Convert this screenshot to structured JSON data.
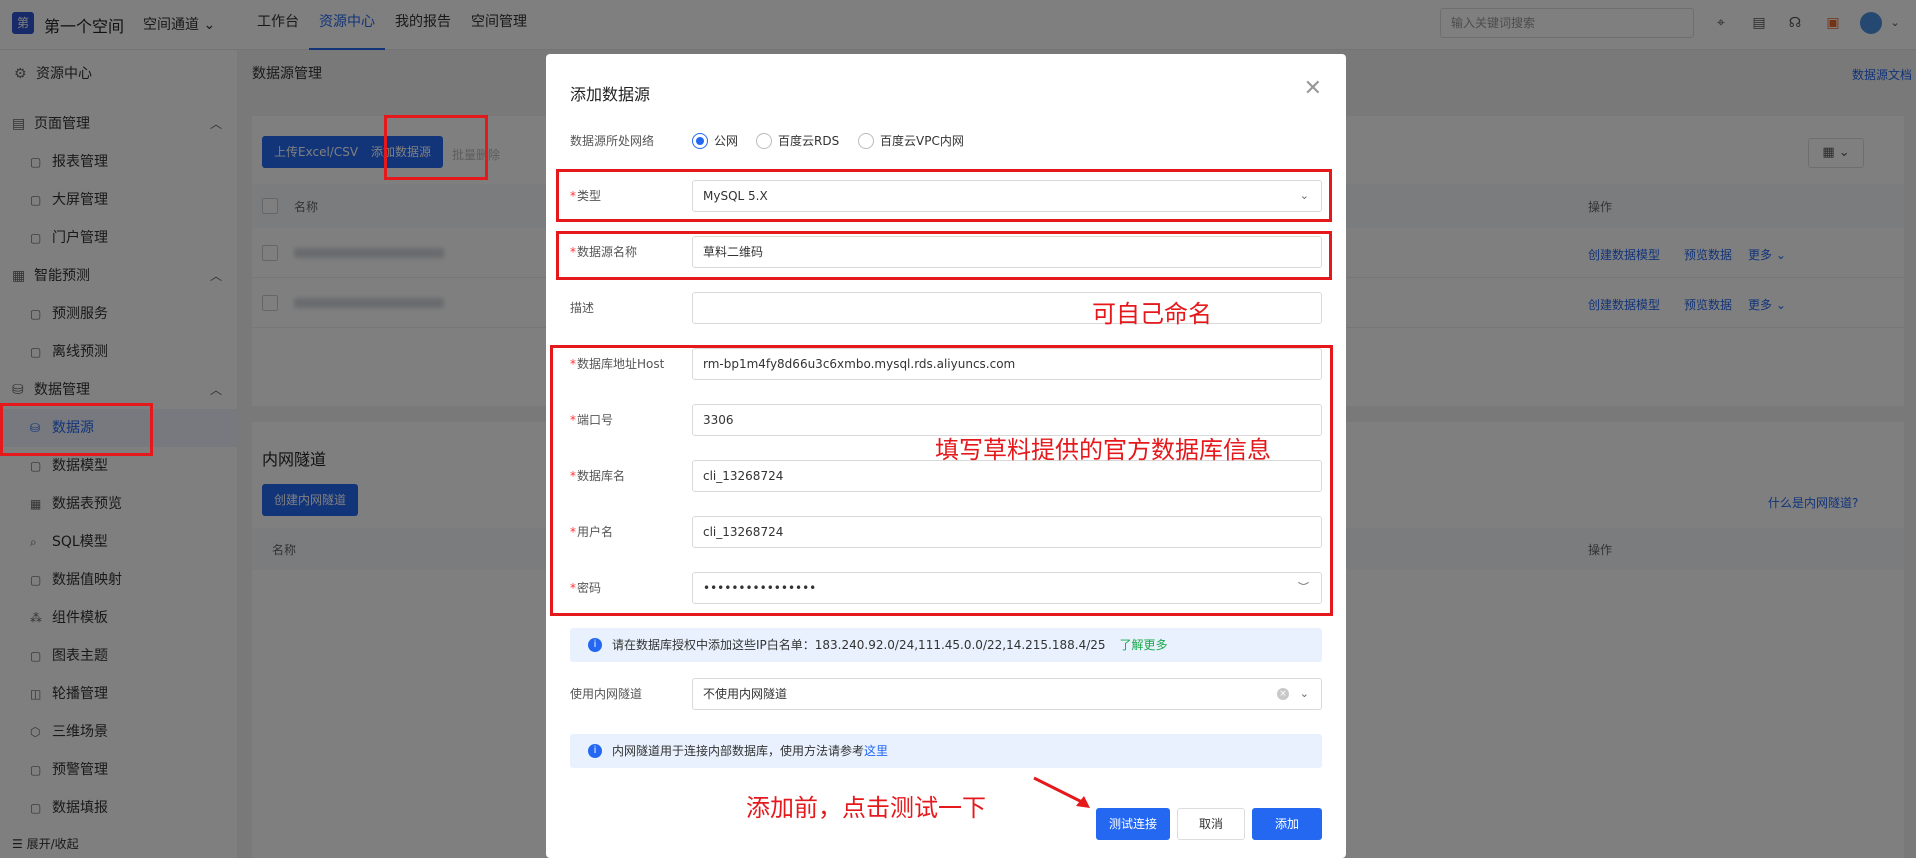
{
  "topbar": {
    "logo": "第",
    "space_name": "第一个空间",
    "space_switch": "空间通道",
    "nav": [
      "工作台",
      "资源中心",
      "我的报告",
      "空间管理"
    ],
    "search_placeholder": "输入关键词搜索"
  },
  "sidebar": {
    "header": "资源中心",
    "groups": [
      {
        "label": "页面管理",
        "items": [
          "报表管理",
          "大屏管理",
          "门户管理"
        ]
      },
      {
        "label": "智能预测",
        "items": [
          "预测服务",
          "离线预测"
        ]
      },
      {
        "label": "数据管理",
        "items": [
          "数据源",
          "数据模型",
          "数据表预览",
          "SQL模型",
          "数据值映射",
          "组件模板",
          "图表主题",
          "轮播管理",
          "三维场景",
          "预警管理",
          "数据填报"
        ]
      }
    ],
    "active_item": "数据源",
    "footer": "展开/收起"
  },
  "main": {
    "breadcrumb": "数据源管理",
    "doc_link": "数据源文档",
    "upload_button": "上传Excel/CSV",
    "add_button": "添加数据源",
    "batch_delete": "批量删除",
    "table_headers": {
      "name": "名称",
      "actions": "操作"
    },
    "rows": [
      {
        "actions": [
          "创建数据模型",
          "预览数据",
          "更多"
        ]
      },
      {
        "actions": [
          "创建数据模型",
          "预览数据",
          "更多"
        ]
      }
    ],
    "row_fragment": "m",
    "tunnel_title": "内网隧道",
    "create_tunnel_button": "创建内网隧道",
    "tunnel_help": "什么是内网隧道?",
    "tunnel_headers": {
      "name": "名称",
      "actions": "操作"
    }
  },
  "modal": {
    "title": "添加数据源",
    "network_label": "数据源所处网络",
    "network_options": [
      "公网",
      "百度云RDS",
      "百度云VPC内网"
    ],
    "network_selected": "公网",
    "type_label": "类型",
    "type_value": "MySQL 5.X",
    "name_label": "数据源名称",
    "name_value": "草料二维码",
    "desc_label": "描述",
    "desc_value": "",
    "host_label": "数据库地址Host",
    "host_value": "rm-bp1m4fy8d66u3c6xmbo.mysql.rds.aliyuncs.com",
    "port_label": "端口号",
    "port_value": "3306",
    "db_label": "数据库名",
    "db_value": "cli_13268724",
    "user_label": "用户名",
    "user_value": "cli_13268724",
    "password_label": "密码",
    "password_value": "••••••••••••••••",
    "whitelist_notice": "请在数据库授权中添加这些IP白名单：183.240.92.0/24,111.45.0.0/22,14.215.188.4/25",
    "whitelist_more": "了解更多",
    "tunnel_label": "使用内网隧道",
    "tunnel_value": "不使用内网隧道",
    "tunnel_notice": "内网隧道用于连接内部数据库，使用方法请参考",
    "tunnel_notice_link": "这里",
    "test_button": "测试连接",
    "cancel_button": "取消",
    "submit_button": "添加"
  },
  "annotations": {
    "rename": "可自己命名",
    "fill_info": "填写草料提供的官方数据库信息",
    "test_first": "添加前，点击测试一下"
  },
  "colors": {
    "primary": "#2468f2",
    "annotation": "#e5191c"
  }
}
